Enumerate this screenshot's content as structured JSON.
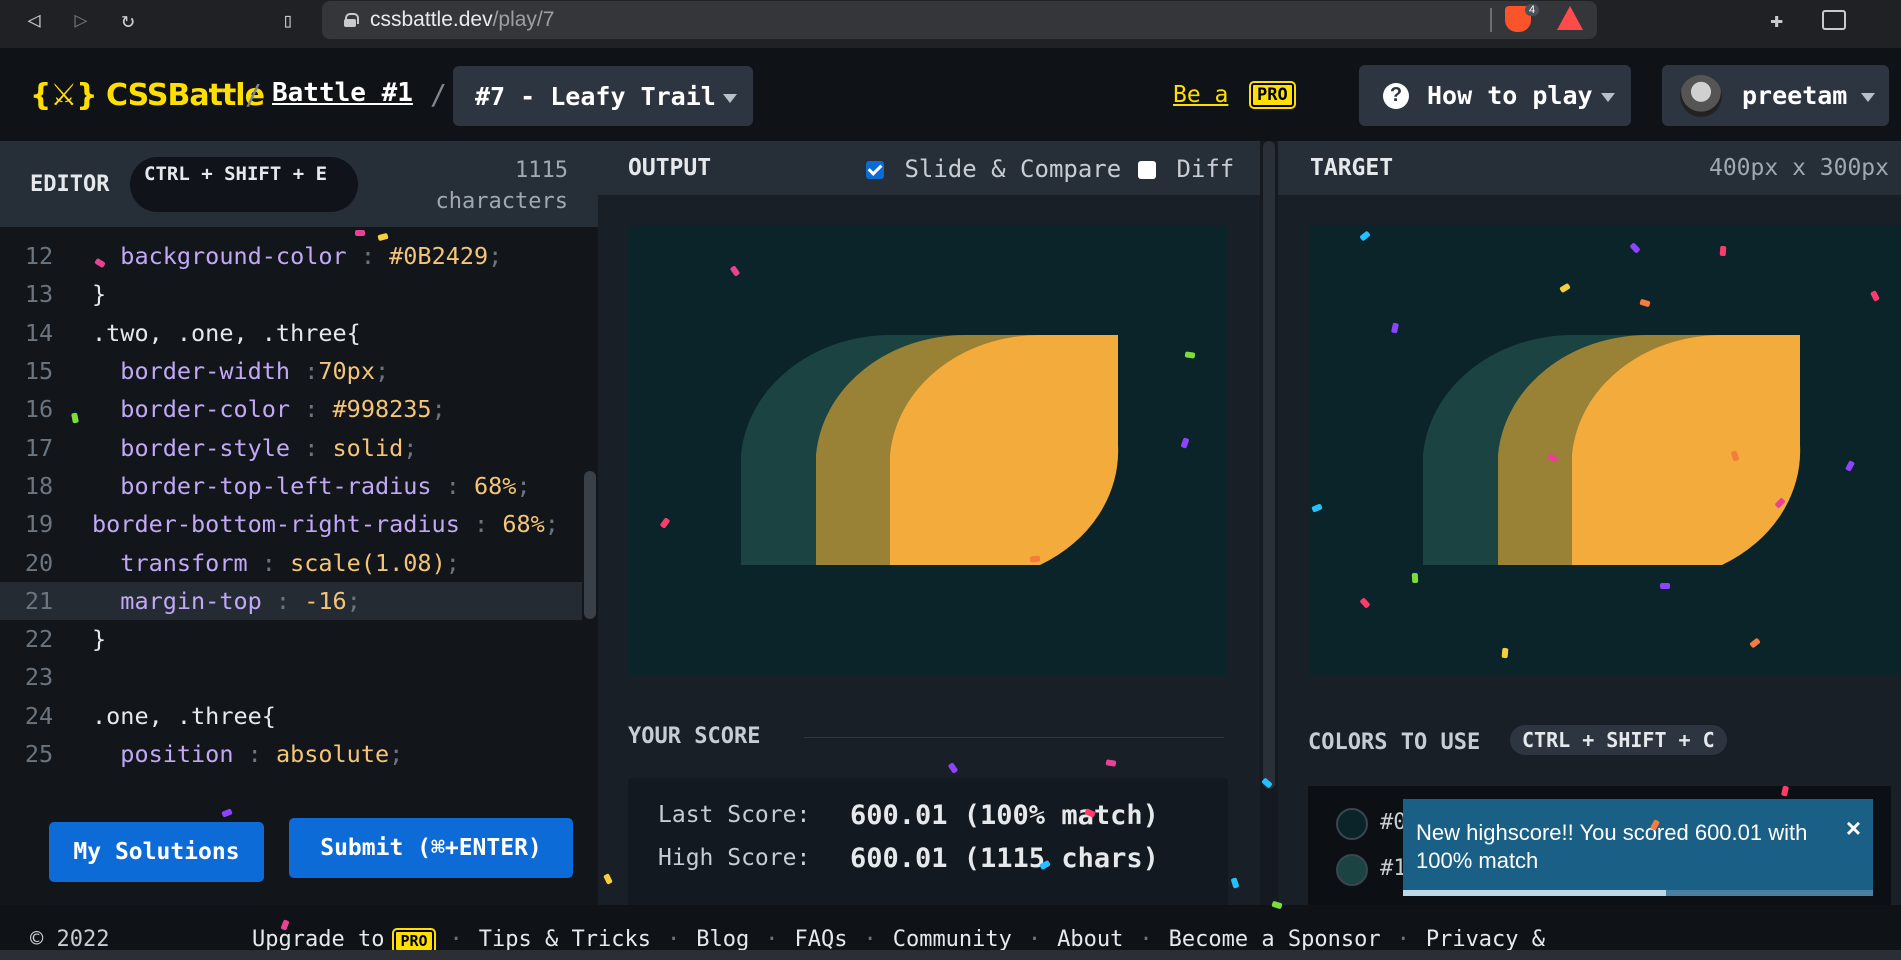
{
  "browser": {
    "url_domain": "cssbattle.dev",
    "url_path": "/play/7",
    "shield_count": "4"
  },
  "header": {
    "logo": "{⚔} CSSBattle",
    "battle_link": "Battle #1",
    "level_select": "#7 - Leafy Trail",
    "be_a": "Be a",
    "pro_badge": "PRO",
    "how_to_play": "How to play",
    "how_to_icon": "?",
    "username": "preetam"
  },
  "editor": {
    "title": "EDITOR",
    "shortcut": "CTRL + SHIFT + E",
    "char_count": "1115",
    "char_label": "characters",
    "lines": [
      {
        "n": "12",
        "indent": "  ",
        "prop": "background-color",
        "sep": " : ",
        "val": "#0B2429",
        "end": ";"
      },
      {
        "n": "13",
        "indent": "",
        "sel": "}"
      },
      {
        "n": "14",
        "indent": "",
        "sel": ".two, .one, .three{"
      },
      {
        "n": "15",
        "indent": "  ",
        "prop": "border-width",
        "sep": " :",
        "val": "70px",
        "end": ";"
      },
      {
        "n": "16",
        "indent": "  ",
        "prop": "border-color",
        "sep": " : ",
        "val": "#998235",
        "end": ";"
      },
      {
        "n": "17",
        "indent": "  ",
        "prop": "border-style",
        "sep": " : ",
        "val": "solid",
        "end": ";"
      },
      {
        "n": "18",
        "indent": "  ",
        "prop": "border-top-left-radius",
        "sep": " : ",
        "val": "68%",
        "end": ";"
      },
      {
        "n": "19",
        "indent": "",
        "prop": "border-bottom-right-radius",
        "sep": " : ",
        "val": "68%",
        "end": ";"
      },
      {
        "n": "20",
        "indent": "  ",
        "prop": "transform",
        "sep": " : ",
        "val": "scale(1.08)",
        "end": ";"
      },
      {
        "n": "21",
        "indent": "  ",
        "prop": "margin-top",
        "sep": " : ",
        "val": "-16",
        "end": ";"
      },
      {
        "n": "22",
        "indent": "",
        "sel": "}"
      },
      {
        "n": "23",
        "indent": "",
        "sel": ""
      },
      {
        "n": "24",
        "indent": "",
        "sel": ".one, .three{"
      },
      {
        "n": "25",
        "indent": "  ",
        "prop": "position",
        "sep": " : ",
        "val": "absolute",
        "end": ";"
      }
    ],
    "my_solutions": "My Solutions",
    "submit": "Submit (⌘+ENTER)"
  },
  "output": {
    "title": "OUTPUT",
    "slide_compare": "Slide & Compare",
    "diff": "Diff",
    "score_title": "YOUR SCORE",
    "last_label": "Last Score:",
    "last_value": "600.01 (100% match)",
    "high_label": "High Score:",
    "high_value": "600.01 (1115 chars)"
  },
  "target": {
    "title": "TARGET",
    "dims": "400px x 300px",
    "colors_title": "COLORS TO USE",
    "colors_shortcut": "CTRL + SHIFT + C",
    "swatches": [
      {
        "label": "#0",
        "color": "#0B2429"
      },
      {
        "label": "#1",
        "color": "#1A4341"
      }
    ]
  },
  "toast": {
    "message": "New highscore!! You scored 600.01 with 100% match",
    "close": "×",
    "progress": 0.56
  },
  "footer": {
    "copyright": "© 2022",
    "links": [
      "Upgrade to",
      "Tips & Tricks",
      "Blog",
      "FAQs",
      "Community",
      "About",
      "Become a Sponsor",
      "Privacy &"
    ]
  },
  "colors": {
    "bg": "#0B2429",
    "leaf_dark": "#1A4341",
    "leaf_mid": "#998235",
    "leaf_light": "#F3AC3C",
    "accent_yellow": "#FFDF00",
    "button_blue": "#0C6BD6"
  }
}
